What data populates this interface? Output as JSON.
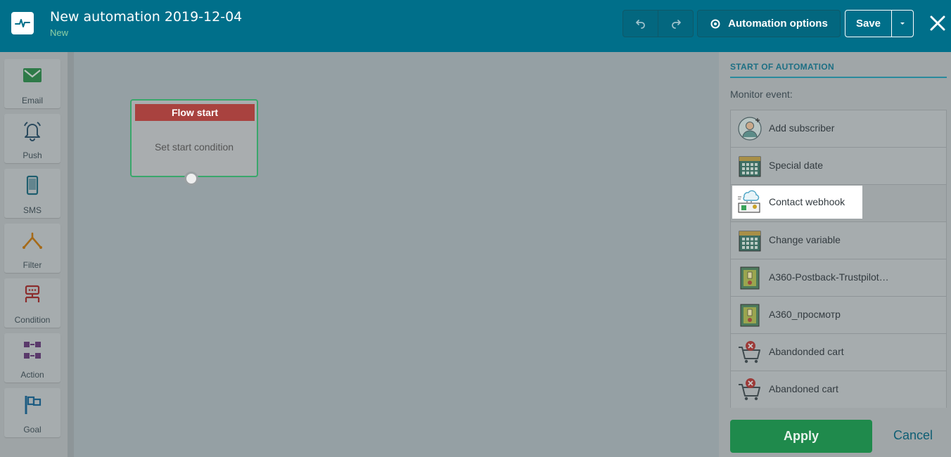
{
  "header": {
    "title": "New automation 2019-12-04",
    "status": "New",
    "options_label": "Automation options",
    "save_label": "Save"
  },
  "toolbox": [
    {
      "label": "Email",
      "icon": "email-icon"
    },
    {
      "label": "Push",
      "icon": "bell-icon"
    },
    {
      "label": "SMS",
      "icon": "phone-icon"
    },
    {
      "label": "Filter",
      "icon": "filter-icon"
    },
    {
      "label": "Condition",
      "icon": "condition-icon"
    },
    {
      "label": "Action",
      "icon": "action-icon"
    },
    {
      "label": "Goal",
      "icon": "flag-icon"
    }
  ],
  "node": {
    "header": "Flow start",
    "body": "Set start condition"
  },
  "panel": {
    "title": "START OF AUTOMATION",
    "monitor_label": "Monitor event:",
    "events": [
      {
        "label": "Add subscriber",
        "icon": "add-user-icon"
      },
      {
        "label": "Special date",
        "icon": "calendar-icon"
      },
      {
        "label": "Contact webhook",
        "icon": "webhook-icon"
      },
      {
        "label": "Change variable",
        "icon": "calendar-icon"
      },
      {
        "label": "A360-Postback-Trustpilot…",
        "icon": "device-icon"
      },
      {
        "label": "A360_просмотр",
        "icon": "device-icon"
      },
      {
        "label": "Abandonded cart",
        "icon": "cart-icon"
      },
      {
        "label": "Abandoned cart",
        "icon": "cart-icon"
      }
    ],
    "apply_label": "Apply",
    "cancel_label": "Cancel"
  },
  "colors": {
    "header_bg": "#006f8a",
    "apply_bg": "#1f8a4c",
    "node_header": "#a9423f",
    "node_border": "#3aa76b"
  }
}
